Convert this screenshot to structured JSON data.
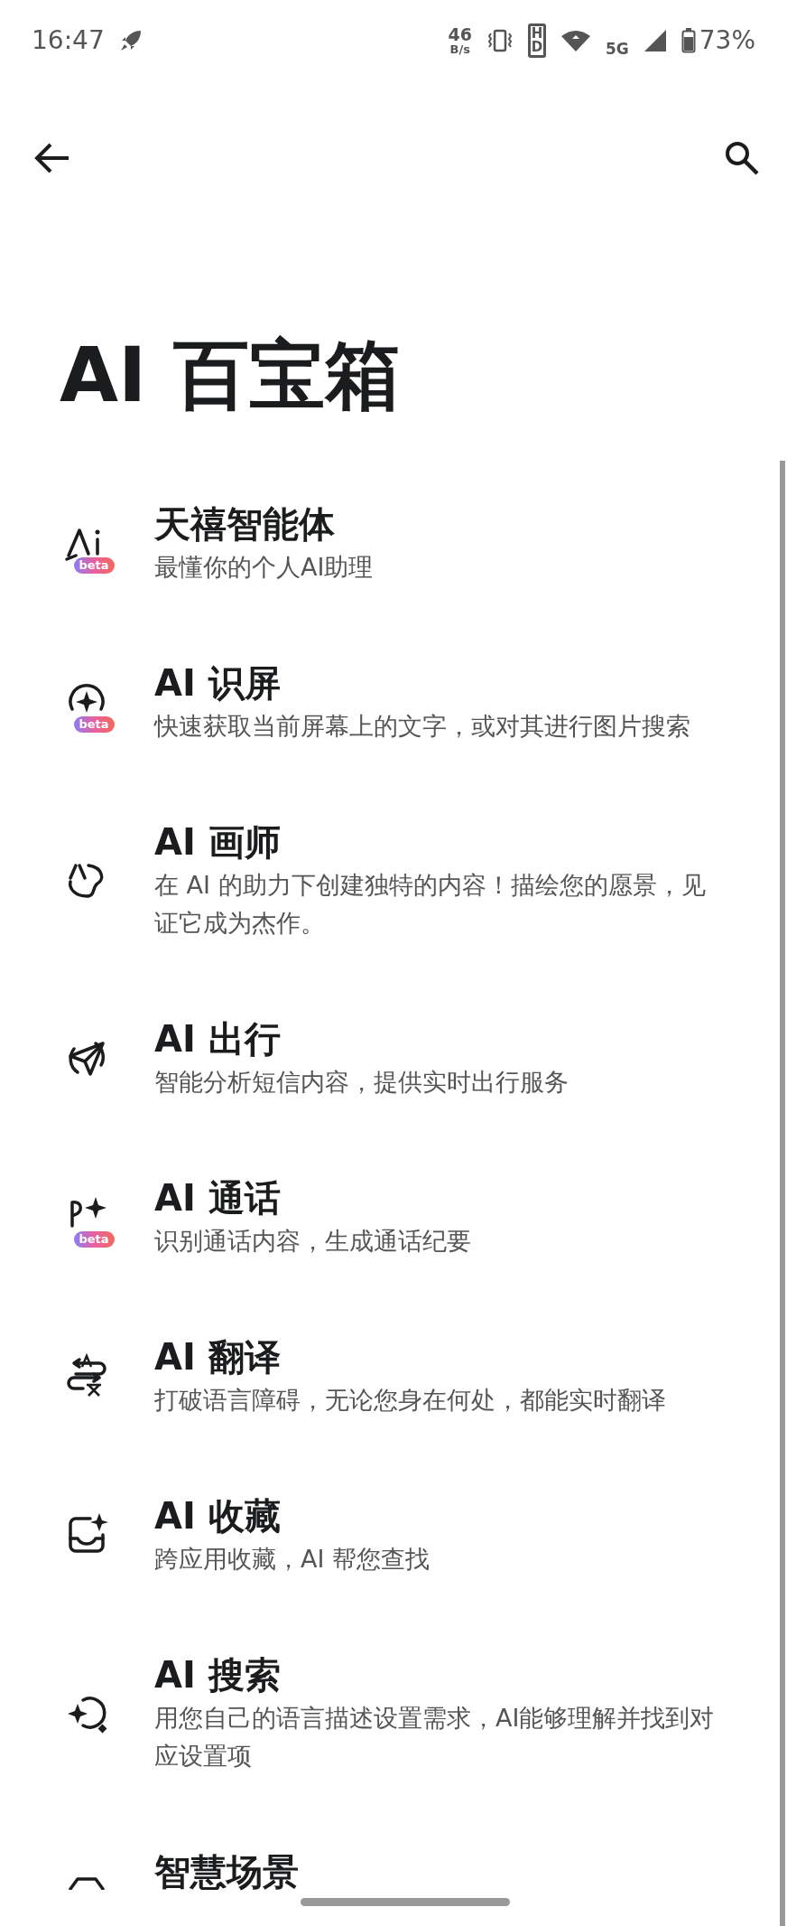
{
  "status_bar": {
    "time": "16:47",
    "speed_value": "46",
    "speed_unit": "B/s",
    "hd": "HD",
    "network": "5G",
    "battery": "73%"
  },
  "page_title": "AI 百宝箱",
  "items": [
    {
      "title": "天禧智能体",
      "subtitle": "最懂你的个人AI助理",
      "badge": "beta"
    },
    {
      "title": "AI 识屏",
      "subtitle": "快速获取当前屏幕上的文字，或对其进行图片搜索",
      "badge": "beta"
    },
    {
      "title": "AI 画师",
      "subtitle": "在 AI 的助力下创建独特的内容！描绘您的愿景，见证它成为杰作。"
    },
    {
      "title": "AI 出行",
      "subtitle": "智能分析短信内容，提供实时出行服务"
    },
    {
      "title": "AI 通话",
      "subtitle": "识别通话内容，生成通话纪要",
      "badge": "beta"
    },
    {
      "title": "AI 翻译",
      "subtitle": "打破语言障碍，无论您身在何处，都能实时翻译"
    },
    {
      "title": "AI 收藏",
      "subtitle": "跨应用收藏，AI 帮您查找"
    },
    {
      "title": "AI 搜索",
      "subtitle": "用您自己的语言描述设置需求，AI能够理解并找到对应设置项"
    },
    {
      "title": "智慧场景"
    }
  ]
}
